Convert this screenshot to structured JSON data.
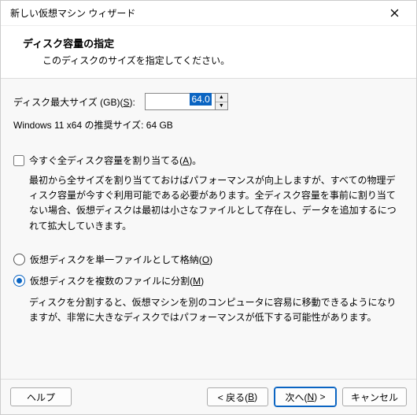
{
  "window": {
    "title": "新しい仮想マシン ウィザード"
  },
  "header": {
    "title": "ディスク容量の指定",
    "subtitle": "このディスクのサイズを指定してください。"
  },
  "disk": {
    "size_label_pre": "ディスク最大サイズ (GB)(",
    "size_label_accel": "S",
    "size_label_post": "):",
    "size_value": "64.0",
    "recommended": "Windows 11 x64 の推奨サイズ: 64 GB"
  },
  "allocate_now": {
    "label_pre": "今すぐ全ディスク容量を割り当てる(",
    "label_accel": "A",
    "label_post": ")。",
    "checked": false,
    "description": "最初から全サイズを割り当てておけばパフォーマンスが向上しますが、すべての物理ディスク容量が今すぐ利用可能である必要があります。全ディスク容量を事前に割り当てない場合、仮想ディスクは最初は小さなファイルとして存在し、データを追加するにつれて拡大していきます。"
  },
  "split": {
    "single_label_pre": "仮想ディスクを単一ファイルとして格納(",
    "single_label_accel": "O",
    "single_label_post": ")",
    "multi_label_pre": "仮想ディスクを複数のファイルに分割(",
    "multi_label_accel": "M",
    "multi_label_post": ")",
    "selected": "multi",
    "description": "ディスクを分割すると、仮想マシンを別のコンピュータに容易に移動できるようになりますが、非常に大きなディスクではパフォーマンスが低下する可能性があります。"
  },
  "footer": {
    "help": "ヘルプ",
    "back_pre": "< 戻る(",
    "back_accel": "B",
    "back_post": ")",
    "next_pre": "次へ(",
    "next_accel": "N",
    "next_post": ") >",
    "cancel": "キャンセル"
  }
}
